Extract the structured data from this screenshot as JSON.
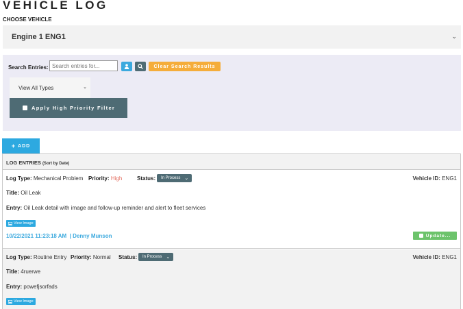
{
  "page": {
    "title": "VEHICLE LOG",
    "choose_vehicle_label": "CHOOSE VEHICLE",
    "selected_vehicle": "Engine 1 ENG1"
  },
  "filters": {
    "search_label": "Search Entries:",
    "search_placeholder": "Search entries for...",
    "search_value": "",
    "clear_label": "Clear Search Results",
    "type_select_value": "View All Types",
    "priority_filter_label": "Apply High Priority Filter",
    "person_icon": "person-icon",
    "search_icon": "search-icon"
  },
  "add_button": {
    "label": "ADD",
    "icon": "plus-icon"
  },
  "log": {
    "header_title": "LOG ENTRIES",
    "header_sort": "(Sort by Date)",
    "labels": {
      "log_type": "Log Type:",
      "priority": "Priority:",
      "status": "Status:",
      "vehicle_id": "Vehicle ID:",
      "title": "Title:",
      "entry": "Entry:",
      "view_image": "View Image",
      "update": "Update..."
    },
    "entries": [
      {
        "log_type": "Mechanical Problem",
        "priority": "High",
        "status": "In Process",
        "vehicle_id": "ENG1",
        "title": "Oil Leak",
        "entry": "Oil Leak detail with image and follow-up reminder and alert to fleet services",
        "date": "10/22/2021 11:23:18 AM",
        "separator": "|",
        "author": "Denny Munson"
      },
      {
        "log_type": "Routine Entry",
        "priority": "Normal",
        "status": "In Process",
        "vehicle_id": "ENG1",
        "title": "4ruerwe",
        "entry": "powefjsorfads"
      }
    ]
  },
  "colors": {
    "accent_blue": "#2da9e0",
    "slate": "#4e6b74",
    "orange": "#f5ad3a",
    "green": "#6cc36b",
    "priority_high": "#e36b5d",
    "panel_bg": "#ecebf5"
  }
}
